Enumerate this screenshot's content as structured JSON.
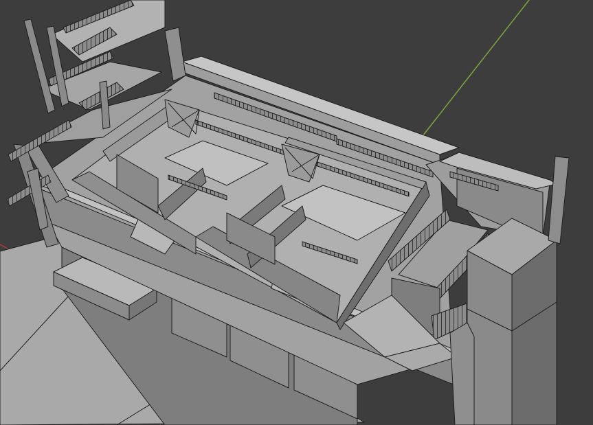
{
  "viewport": {
    "background": "#3d3d3d",
    "shading": "solid-gray",
    "colors": {
      "floor": "#a7a7a7",
      "floor_light": "#b4b4b4",
      "wall_light": "#9a9a9a",
      "wall_mid": "#8a8a8a",
      "wall_dark": "#747474",
      "edge": "#1e1e1e",
      "y_axis": "#7fa83a",
      "x_axis": "#b03a3a"
    },
    "axes_visible": [
      "x-axis",
      "y-axis"
    ]
  },
  "scene": {
    "object_type": "building-mesh",
    "parts": [
      "roof-parapet",
      "interior-rooms",
      "staircase",
      "fire-escape",
      "storefront",
      "sidewalk",
      "chimney-column"
    ]
  }
}
